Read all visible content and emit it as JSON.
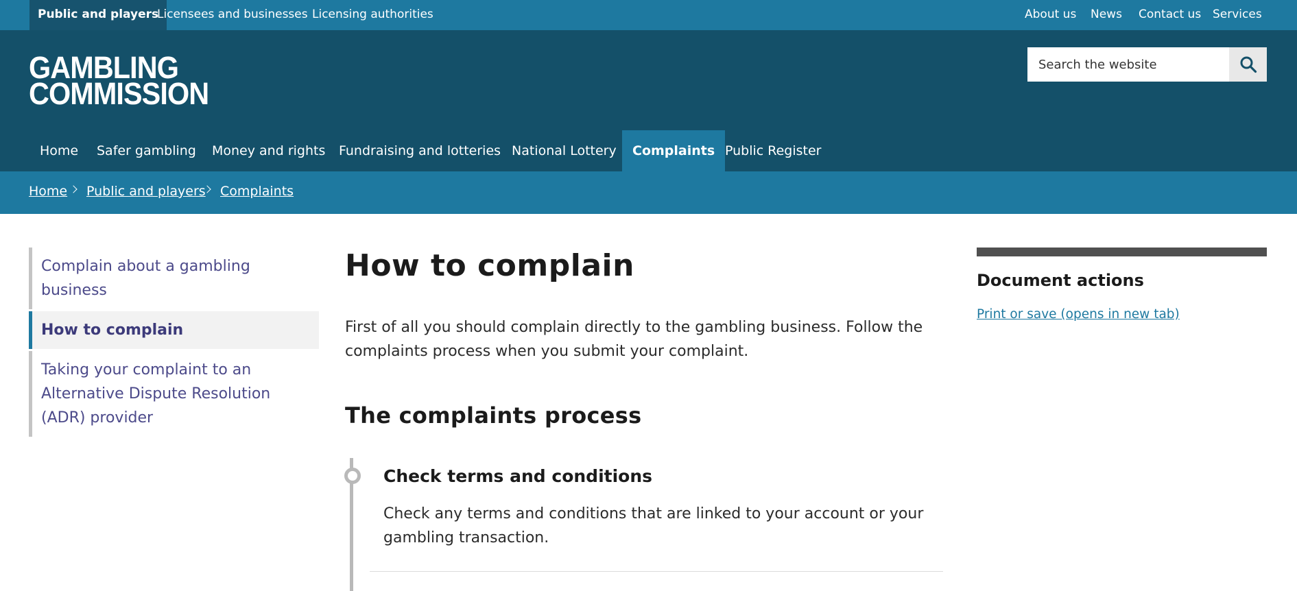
{
  "topbar": {
    "audiences": [
      "Public and players",
      "Licensees and businesses",
      "Licensing authorities"
    ],
    "utility_links": [
      "About us",
      "News",
      "Contact us",
      "Services"
    ]
  },
  "header": {
    "logo_line1": "GAMBLING",
    "logo_line2": "COMMISSION",
    "search_placeholder": "Search the website",
    "search_icon": "search-icon"
  },
  "main_nav": [
    "Home",
    "Safer gambling",
    "Money and rights",
    "Fundraising and lotteries",
    "National Lottery",
    "Complaints",
    "Public Register"
  ],
  "main_nav_active": "Complaints",
  "breadcrumb": [
    "Home",
    "Public and players",
    "Complaints"
  ],
  "sidenav": [
    {
      "label": "Complain about a gambling business"
    },
    {
      "label": "How to complain",
      "active": true
    },
    {
      "label": "Taking your complaint to an Alternative Dispute Resolution (ADR) provider"
    }
  ],
  "content": {
    "title": "How to complain",
    "intro": "First of all you should complain directly to the gambling business. Follow the complaints process when you submit your complaint.",
    "section_title": "The complaints process",
    "steps": [
      {
        "title": "Check terms and conditions",
        "text": "Check any terms and conditions that are linked to your account or your gambling transaction."
      }
    ]
  },
  "document_actions": {
    "title": "Document actions",
    "link": "Print or save (opens in new tab)"
  },
  "colors": {
    "topbar": "#1e79a0",
    "header": "#145069",
    "breadcrumb_bar": "#1e79a0",
    "side_link": "#4c4a8a",
    "link": "#1e79a0"
  }
}
